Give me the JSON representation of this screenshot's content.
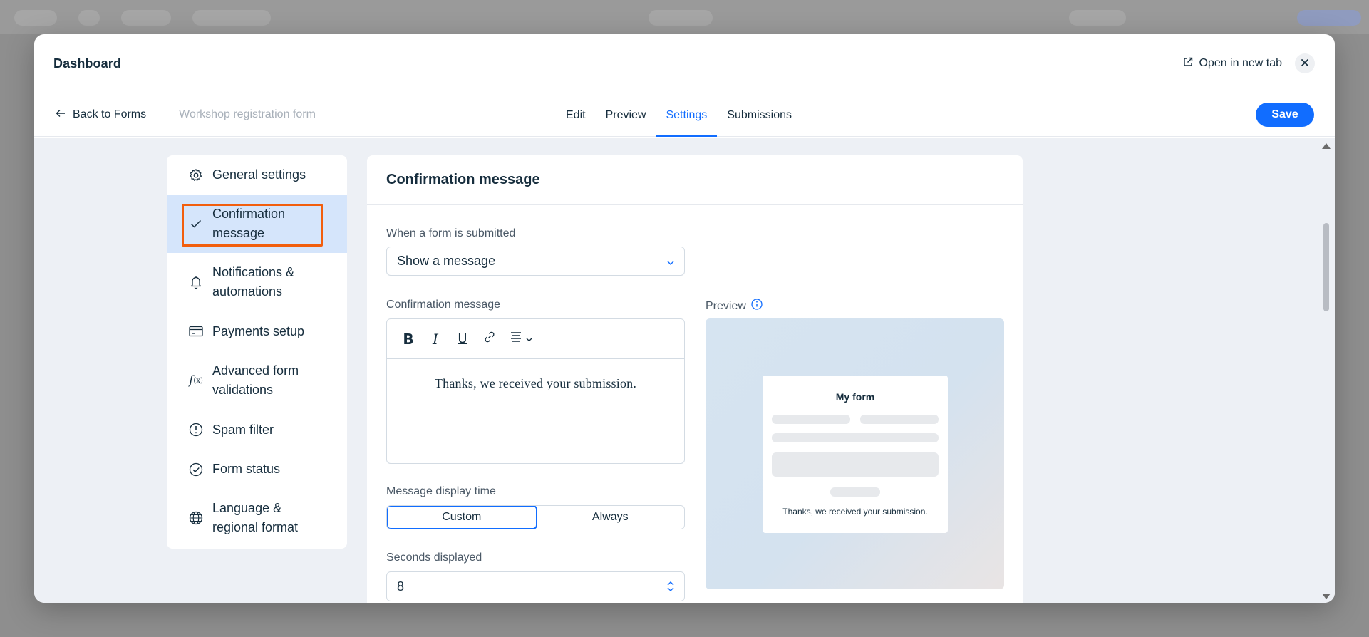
{
  "modal": {
    "title": "Dashboard",
    "open_new_tab": "Open in new tab"
  },
  "toolbar": {
    "back_label": "Back to Forms",
    "form_name": "Workshop registration form",
    "tabs": [
      {
        "label": "Edit"
      },
      {
        "label": "Preview"
      },
      {
        "label": "Settings",
        "active": true
      },
      {
        "label": "Submissions"
      }
    ],
    "save_label": "Save"
  },
  "sidebar": {
    "items": [
      {
        "label": "General settings",
        "icon": "gear-icon"
      },
      {
        "label": "Confirmation message",
        "icon": "check-icon",
        "active": true
      },
      {
        "label": "Notifications & automations",
        "icon": "bell-icon"
      },
      {
        "label": "Payments setup",
        "icon": "credit-card-icon"
      },
      {
        "label": "Advanced form validations",
        "icon": "function-icon"
      },
      {
        "label": "Spam filter",
        "icon": "alert-circle-icon"
      },
      {
        "label": "Form status",
        "icon": "check-circle-icon"
      },
      {
        "label": "Language & regional format",
        "icon": "globe-icon"
      }
    ]
  },
  "panel": {
    "title": "Confirmation message",
    "submit_action_label": "When a form is submitted",
    "submit_action_value": "Show a message",
    "message_label": "Confirmation message",
    "message_text": "Thanks, we received your submission.",
    "display_time_label": "Message display time",
    "display_options": [
      {
        "label": "Custom",
        "active": true
      },
      {
        "label": "Always"
      }
    ],
    "seconds_label": "Seconds displayed",
    "seconds_value": "8",
    "preview_label": "Preview",
    "preview_form_title": "My form",
    "preview_message": "Thanks, we received your submission."
  },
  "colors": {
    "accent": "#116dff",
    "highlight": "#f25e0d",
    "active_item_bg": "#d5e5fb"
  }
}
